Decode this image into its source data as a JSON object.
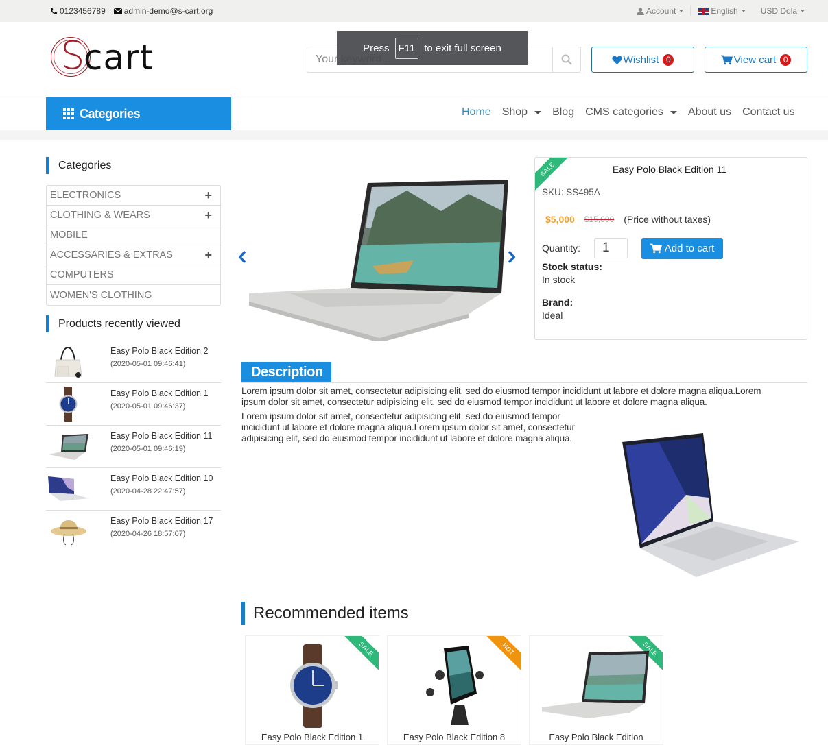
{
  "topbar": {
    "phone": "0123456789",
    "email": "admin-demo@s-cart.org",
    "account": "Account",
    "language": "English",
    "currency": "USD Dola"
  },
  "header": {
    "logo_s": "S",
    "logo_rest": "cart",
    "search_placeholder": "Your keyword...",
    "wishlist_label": "Wishlist",
    "wishlist_count": "0",
    "cart_label": "View cart",
    "cart_count": "0"
  },
  "fullscreen_notice": {
    "before": "Press",
    "key": "F11",
    "after": "to exit full screen"
  },
  "navbar": {
    "categories_label": "Categories",
    "menu": [
      {
        "label": "Home",
        "active": true
      },
      {
        "label": "Shop",
        "dropdown": true
      },
      {
        "label": "Blog"
      },
      {
        "label": "CMS categories",
        "dropdown": true
      },
      {
        "label": "About us"
      },
      {
        "label": "Contact us"
      }
    ]
  },
  "sidebar": {
    "categories_title": "Categories",
    "categories": [
      {
        "label": "ELECTRONICS",
        "expandable": true
      },
      {
        "label": "CLOTHING & WEARS",
        "expandable": true
      },
      {
        "label": "MOBILE",
        "expandable": false
      },
      {
        "label": "ACCESSARIES & EXTRAS",
        "expandable": true
      },
      {
        "label": "COMPUTERS",
        "expandable": false
      },
      {
        "label": "WOMEN'S CLOTHING",
        "expandable": false
      }
    ],
    "recent_title": "Products recently viewed",
    "recent": [
      {
        "name": "Easy Polo Black Edition 2",
        "date": "(2020-05-01 09:46:41)",
        "image": "handbag"
      },
      {
        "name": "Easy Polo Black Edition 1",
        "date": "(2020-05-01 09:46:37)",
        "image": "watch"
      },
      {
        "name": "Easy Polo Black Edition 11",
        "date": "(2020-05-01 09:46:19)",
        "image": "laptop-hp"
      },
      {
        "name": "Easy Polo Black Edition 10",
        "date": "(2020-04-28 22:47:57)",
        "image": "laptop-asus"
      },
      {
        "name": "Easy Polo Black Edition 17",
        "date": "(2020-04-26 18:57:07)",
        "image": "hat"
      }
    ]
  },
  "product": {
    "badge": "SALE",
    "title": "Easy Polo Black Edition 11",
    "sku": "SKU: SS495A",
    "price": "$5,000",
    "old_price": "$15,000",
    "price_note": "(Price without taxes)",
    "quantity_label": "Quantity:",
    "quantity": "1",
    "add_to_cart": "Add to cart",
    "stock_label": "Stock status:",
    "stock_value": "In stock",
    "brand_label": "Brand:",
    "brand_value": "Ideal"
  },
  "description": {
    "tab_label": "Description",
    "paragraph1_line1": "Lorem ipsum dolor sit amet, consectetur adipisicing elit, sed do eiusmod tempor incididunt ut labore et dolore magna aliqua.Lorem",
    "paragraph1_line2": "ipsum dolor sit amet, consectetur adipisicing elit, sed do eiusmod tempor incididunt ut labore et dolore magna aliqua.",
    "paragraph2_line1": "Lorem ipsum dolor sit amet, consectetur adipisicing elit, sed do eiusmod tempor",
    "paragraph2_line2": "incididunt ut labore et dolore magna aliqua.Lorem ipsum dolor sit amet, consectetur",
    "paragraph2_line3": "adipisicing elit, sed do eiusmod tempor incididunt ut labore et dolore magna aliqua."
  },
  "recommended": {
    "title": "Recommended items",
    "items": [
      {
        "name": "Easy Polo Black Edition 1",
        "badge": "SALE",
        "image": "watch"
      },
      {
        "name": "Easy Polo Black Edition 8",
        "badge": "HOT",
        "image": "phone-holder"
      },
      {
        "name": "Easy Polo Black Edition",
        "badge": "SALE",
        "image": "laptop-hp"
      }
    ]
  },
  "colors": {
    "primary": "#1a8ee1",
    "sale": "#2eb87a",
    "hot": "#f0930e",
    "price": "#f0a030",
    "badge": "#d61a1a"
  }
}
